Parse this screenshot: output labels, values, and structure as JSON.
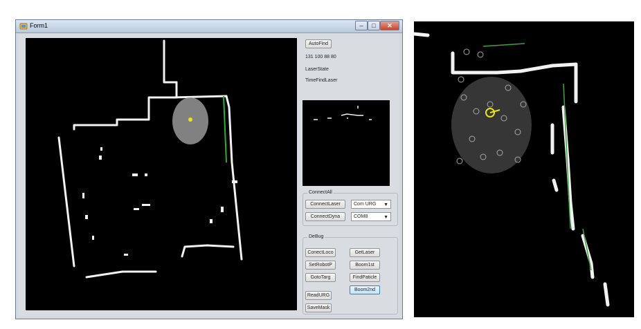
{
  "window": {
    "title": "Form1",
    "minimize": "–",
    "maximize": "□",
    "close": "✕"
  },
  "autofind_button": "AutoFind",
  "readout_values": "131 100 88 80",
  "laser_state_label": "LaserState",
  "time_find_laser_label": "TimeFindLaser",
  "connect_group": {
    "title": "ConnectAll",
    "connect_laser": "ConnectLaser",
    "connect_dyna": "ConnectDyna",
    "laser_port": "Com URG",
    "dyna_port": "COM8"
  },
  "debug_group": {
    "title": "DeBug",
    "buttons": {
      "connect_loco": "ConectLoco",
      "get_laser": "GetLaser",
      "set_robot_p": "SetRobotP",
      "boom_1st": "Boom1st",
      "goto_targ": "GotoTarg",
      "find_particle": "FindPaticle",
      "boom_2nd": "Boom2nd",
      "read_urg": "ReadURG",
      "save_mask": "SaveMask"
    }
  },
  "colors": {
    "map_bg": "#000000",
    "wall": "#f2f2f2",
    "particles": "#9a9a9a",
    "laser_hits": "#2fae2f",
    "robot": "#e8e800"
  }
}
